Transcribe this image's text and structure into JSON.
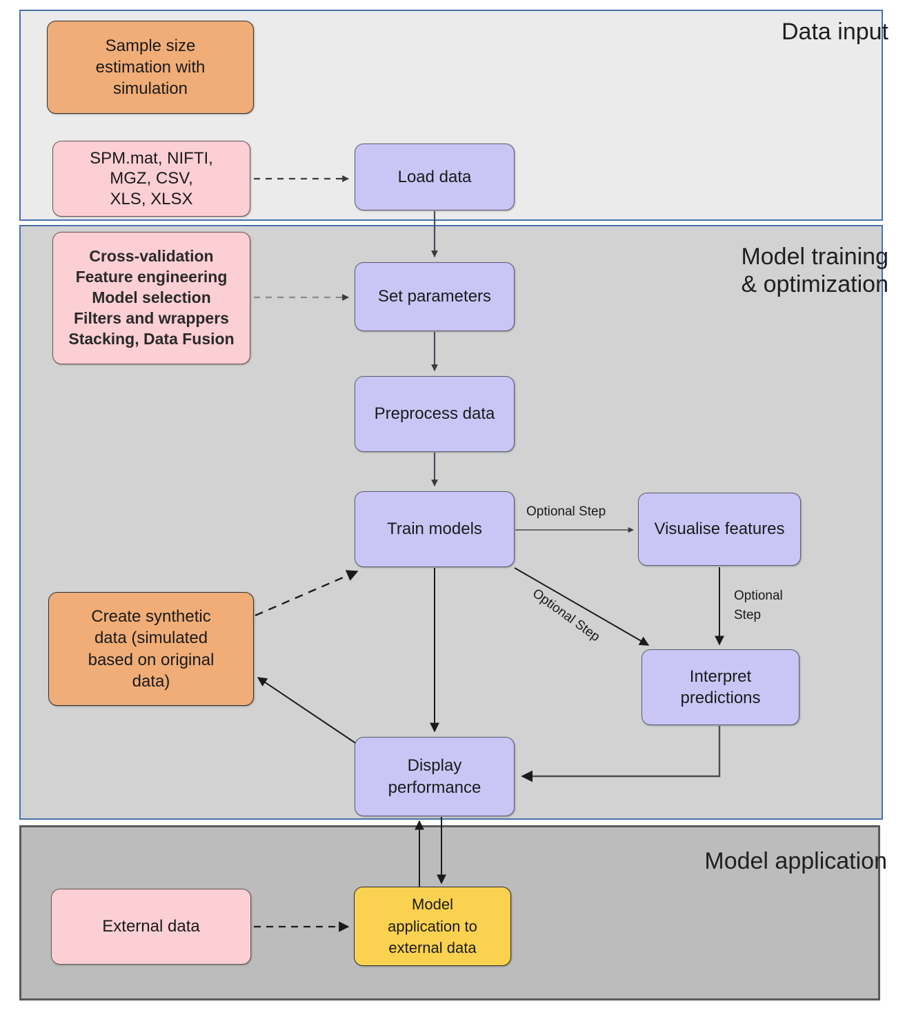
{
  "diagram": {
    "title_not_shown": "",
    "sections": [
      {
        "id": "data-input",
        "title": "Data input"
      },
      {
        "id": "model-training",
        "title": "Model training\n& optimization"
      },
      {
        "id": "model-application",
        "title": "Model application"
      }
    ],
    "nodes": [
      {
        "id": "sample-size",
        "label": "Sample size\nestimation with\nsimulation",
        "color": "#f0ad77"
      },
      {
        "id": "file-formats",
        "label": "SPM.mat, NIFTI,\nMGZ, CSV,\nXLS, XLSX",
        "color": "#fbcfd4"
      },
      {
        "id": "load-data",
        "label": "Load data",
        "color": "#c9c6f5"
      },
      {
        "id": "config-list",
        "label": "Cross-validation\nFeature engineering\nModel selection\nFilters and wrappers\nStacking, Data Fusion",
        "color": "#fbcfd4"
      },
      {
        "id": "set-parameters",
        "label": "Set parameters",
        "color": "#c9c6f5"
      },
      {
        "id": "preprocess-data",
        "label": "Preprocess data",
        "color": "#c9c6f5"
      },
      {
        "id": "train-models",
        "label": "Train models",
        "color": "#c9c6f5"
      },
      {
        "id": "visualise",
        "label": "Visualise features",
        "color": "#c9c6f5"
      },
      {
        "id": "synthetic",
        "label": "Create synthetic\ndata (simulated\nbased on original\ndata)",
        "color": "#f0ad77"
      },
      {
        "id": "interpret",
        "label": "Interpret\npredictions",
        "color": "#c9c6f5"
      },
      {
        "id": "display-perf",
        "label": "Display\nperformance",
        "color": "#c9c6f5"
      },
      {
        "id": "external-data",
        "label": "External data",
        "color": "#fbcfd4"
      },
      {
        "id": "model-app",
        "label": "Model\napplication to\nexternal data",
        "color": "#fad250"
      }
    ],
    "edge_labels": {
      "train_to_visualise": "Optional Step",
      "train_to_interpret": "Optional Step",
      "visualise_to_interpret": "Optional\nStep"
    },
    "colors": {
      "panel_data_input_bg": "#ebebeb",
      "panel_model_training_bg": "#d2d2d2",
      "panel_model_application_bg": "#bcbcbc",
      "panel_border_blue": "#4472a8",
      "panel_border_dark": "#595959",
      "node_orange": "#f0ad77",
      "node_pink": "#fbcfd4",
      "node_purple": "#c9c6f5",
      "node_yellow": "#fad250",
      "edge_stroke": "#1a1a1a"
    }
  }
}
